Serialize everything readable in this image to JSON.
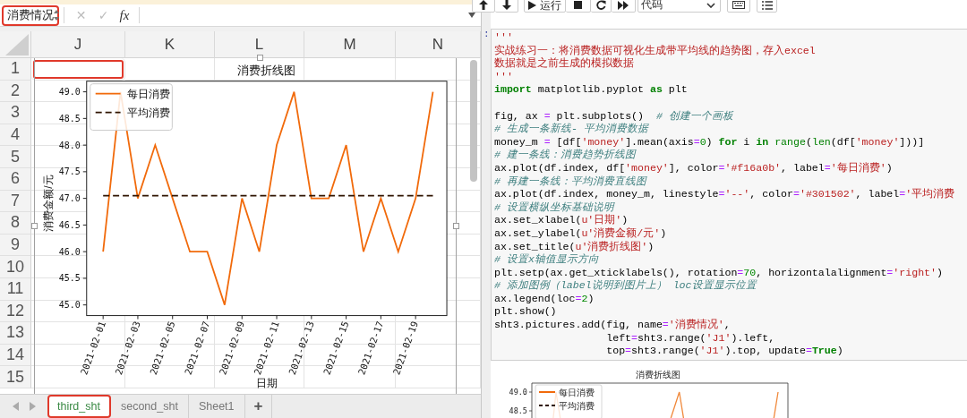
{
  "spreadsheet": {
    "name_box": {
      "value": "消费情况",
      "highlighted": true
    },
    "formula_bar": {
      "cancel": "✕",
      "confirm": "✓",
      "function": "fx"
    },
    "columns": [
      "J",
      "K",
      "L",
      "M",
      "N"
    ],
    "anchor_cell": {
      "highlighted": true
    },
    "rows": [
      "1",
      "2",
      "3",
      "4",
      "5",
      "6",
      "7",
      "8",
      "9",
      "10",
      "11",
      "12",
      "13",
      "14",
      "15"
    ],
    "picture": {
      "chart_data": {
        "type": "line",
        "title": "消费折线图",
        "xlabel": "日期",
        "ylabel": "消费金额/元",
        "categories": [
          "2021-02-01",
          null,
          "2021-02-03",
          null,
          "2021-02-05",
          null,
          "2021-02-07",
          null,
          "2021-02-09",
          null,
          "2021-02-11",
          null,
          "2021-02-13",
          null,
          "2021-02-15",
          null,
          "2021-02-17",
          null,
          "2021-02-19",
          null
        ],
        "series": [
          {
            "name": "每日消费",
            "color": "#f16a0b",
            "line_style": "solid",
            "values": [
              46,
              49,
              47,
              48,
              47,
              46,
              46,
              45,
              47,
              46,
              48,
              49,
              47,
              47,
              48,
              46,
              47,
              46,
              47,
              49
            ]
          },
          {
            "name": "平均消费",
            "color": "#301502",
            "line_style": "dashed",
            "values": [
              47.05,
              47.05,
              47.05,
              47.05,
              47.05,
              47.05,
              47.05,
              47.05,
              47.05,
              47.05,
              47.05,
              47.05,
              47.05,
              47.05,
              47.05,
              47.05,
              47.05,
              47.05,
              47.05,
              47.05
            ]
          }
        ],
        "ylim": [
          44.8,
          49.2
        ],
        "legend": true,
        "yticks": [
          {
            "value": 45,
            "label": "45.0"
          },
          {
            "value": 45.5,
            "label": "45.5"
          },
          {
            "value": 46,
            "label": "46.0"
          },
          {
            "value": 46.5,
            "label": "46.5"
          },
          {
            "value": 47,
            "label": "47.0"
          },
          {
            "value": 47.5,
            "label": "47.5"
          },
          {
            "value": 48,
            "label": "48.0"
          },
          {
            "value": 48.5,
            "label": "48.5"
          },
          {
            "value": 49,
            "label": "49.0"
          }
        ]
      }
    },
    "sheet_tabs": [
      {
        "label": "third_sht",
        "selected": true,
        "highlighted": true
      },
      {
        "label": "second_sht",
        "selected": false,
        "highlighted": false
      },
      {
        "label": "Sheet1",
        "selected": false,
        "highlighted": false
      }
    ],
    "add_sheet": "+"
  },
  "notebook": {
    "toolbar": {
      "run": "运行",
      "cell_type": "代码"
    },
    "prompt": ":",
    "code_lines": [
      {
        "tokens": [
          {
            "kind": "str",
            "text": "'''"
          }
        ]
      },
      {
        "tokens": [
          {
            "kind": "str",
            "text": "实战练习一：将消费数据可视化生成带平均线的趋势图，存入excel"
          }
        ]
      },
      {
        "tokens": [
          {
            "kind": "str",
            "text": "数据就是之前生成的模拟数据"
          }
        ]
      },
      {
        "tokens": [
          {
            "kind": "str",
            "text": "'''"
          }
        ]
      },
      {
        "tokens": [
          {
            "kind": "kw",
            "text": "import"
          },
          {
            "kind": "plain",
            "text": " matplotlib.pyplot "
          },
          {
            "kind": "kw",
            "text": "as"
          },
          {
            "kind": "plain",
            "text": " plt"
          }
        ]
      },
      {
        "blank_before": true,
        "tokens": [
          {
            "kind": "plain",
            "text": "fig, ax "
          },
          {
            "kind": "op",
            "text": "="
          },
          {
            "kind": "plain",
            "text": " plt.subplots()  "
          },
          {
            "kind": "comment",
            "text": "# 创建一个画板"
          }
        ]
      },
      {
        "tokens": [
          {
            "kind": "comment",
            "text": "# 生成一条新线- 平均消费数据"
          }
        ]
      },
      {
        "tokens": [
          {
            "kind": "plain",
            "text": "money_m "
          },
          {
            "kind": "op",
            "text": "="
          },
          {
            "kind": "plain",
            "text": " [df["
          },
          {
            "kind": "str",
            "text": "'money'"
          },
          {
            "kind": "plain",
            "text": "].mean(axis"
          },
          {
            "kind": "op",
            "text": "="
          },
          {
            "kind": "num",
            "text": "0"
          },
          {
            "kind": "plain",
            "text": ") "
          },
          {
            "kind": "kw",
            "text": "for"
          },
          {
            "kind": "plain",
            "text": " i "
          },
          {
            "kind": "kw",
            "text": "in"
          },
          {
            "kind": "builtin",
            "text": " range"
          },
          {
            "kind": "plain",
            "text": "("
          },
          {
            "kind": "builtin",
            "text": "len"
          },
          {
            "kind": "plain",
            "text": "(df["
          },
          {
            "kind": "str",
            "text": "'money'"
          },
          {
            "kind": "plain",
            "text": "]))]"
          }
        ]
      },
      {
        "tokens": [
          {
            "kind": "comment",
            "text": "# 建一条线：消费趋势折线图"
          }
        ]
      },
      {
        "tokens": [
          {
            "kind": "plain",
            "text": "ax.plot(df.index, df["
          },
          {
            "kind": "str",
            "text": "'money'"
          },
          {
            "kind": "plain",
            "text": "], color"
          },
          {
            "kind": "op",
            "text": "="
          },
          {
            "kind": "str",
            "text": "'#f16a0b'"
          },
          {
            "kind": "plain",
            "text": ", label"
          },
          {
            "kind": "op",
            "text": "="
          },
          {
            "kind": "str",
            "text": "'每日消费'"
          },
          {
            "kind": "plain",
            "text": ")"
          }
        ]
      },
      {
        "tokens": [
          {
            "kind": "comment",
            "text": "# 再建一条线：平均消费直线图"
          }
        ]
      },
      {
        "tokens": [
          {
            "kind": "plain",
            "text": "ax.plot(df.index, money_m, linestyle"
          },
          {
            "kind": "op",
            "text": "="
          },
          {
            "kind": "str",
            "text": "'--'"
          },
          {
            "kind": "plain",
            "text": ", color"
          },
          {
            "kind": "op",
            "text": "="
          },
          {
            "kind": "str",
            "text": "'#301502'"
          },
          {
            "kind": "plain",
            "text": ", label"
          },
          {
            "kind": "op",
            "text": "="
          },
          {
            "kind": "str",
            "text": "'平均消费"
          }
        ]
      },
      {
        "tokens": [
          {
            "kind": "comment",
            "text": "# 设置横纵坐标基础说明"
          }
        ]
      },
      {
        "tokens": [
          {
            "kind": "plain",
            "text": "ax.set_xlabel("
          },
          {
            "kind": "str",
            "text": "u'日期'"
          },
          {
            "kind": "plain",
            "text": ")"
          }
        ]
      },
      {
        "tokens": [
          {
            "kind": "plain",
            "text": "ax.set_ylabel("
          },
          {
            "kind": "str",
            "text": "u'消费金额/元'"
          },
          {
            "kind": "plain",
            "text": ")"
          }
        ]
      },
      {
        "tokens": [
          {
            "kind": "plain",
            "text": "ax.set_title("
          },
          {
            "kind": "str",
            "text": "u'消费折线图'"
          },
          {
            "kind": "plain",
            "text": ")"
          }
        ]
      },
      {
        "tokens": [
          {
            "kind": "comment",
            "text": "# 设置x轴值显示方向"
          }
        ]
      },
      {
        "tokens": [
          {
            "kind": "plain",
            "text": "plt.setp(ax.get_xticklabels(), rotation"
          },
          {
            "kind": "op",
            "text": "="
          },
          {
            "kind": "num",
            "text": "70"
          },
          {
            "kind": "plain",
            "text": ", horizontalalignment"
          },
          {
            "kind": "op",
            "text": "="
          },
          {
            "kind": "str",
            "text": "'right'"
          },
          {
            "kind": "plain",
            "text": ")"
          }
        ]
      },
      {
        "tokens": [
          {
            "kind": "comment",
            "text": "# 添加图例（label说明到图片上） loc设置显示位置"
          }
        ]
      },
      {
        "tokens": [
          {
            "kind": "plain",
            "text": "ax.legend(loc"
          },
          {
            "kind": "op",
            "text": "="
          },
          {
            "kind": "num",
            "text": "2"
          },
          {
            "kind": "plain",
            "text": ")"
          }
        ]
      },
      {
        "tokens": [
          {
            "kind": "plain",
            "text": "plt.show()"
          }
        ]
      },
      {
        "tokens": [
          {
            "kind": "plain",
            "text": "sht3.pictures.add(fig, name"
          },
          {
            "kind": "op",
            "text": "="
          },
          {
            "kind": "str",
            "text": "'消费情况'"
          },
          {
            "kind": "plain",
            "text": ","
          }
        ]
      },
      {
        "tokens": [
          {
            "kind": "plain",
            "text": "                  left"
          },
          {
            "kind": "op",
            "text": "="
          },
          {
            "kind": "plain",
            "text": "sht3.range("
          },
          {
            "kind": "str",
            "text": "'J1'"
          },
          {
            "kind": "plain",
            "text": ").left,"
          }
        ]
      },
      {
        "tokens": [
          {
            "kind": "plain",
            "text": "                  top"
          },
          {
            "kind": "op",
            "text": "="
          },
          {
            "kind": "plain",
            "text": "sht3.range("
          },
          {
            "kind": "str",
            "text": "'J1'"
          },
          {
            "kind": "plain",
            "text": ").top, update"
          },
          {
            "kind": "op",
            "text": "="
          },
          {
            "kind": "kw",
            "text": "True"
          },
          {
            "kind": "plain",
            "text": ")"
          }
        ]
      }
    ],
    "output": {
      "title": "消费折线图",
      "y_tick_labels": [
        "49.0",
        "48.5"
      ],
      "legend": [
        {
          "label": "每日消费",
          "color": "#f16a0b",
          "kind": "solid"
        },
        {
          "label": "平均消费",
          "color": "#301502",
          "kind": "dashed"
        }
      ]
    }
  }
}
